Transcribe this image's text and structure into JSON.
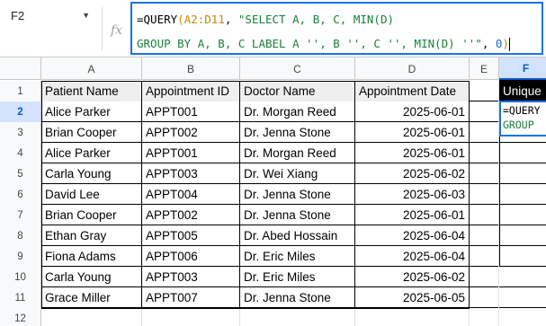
{
  "namebox": {
    "cell_ref": "F2"
  },
  "formula_bar": {
    "fx_label": "fx",
    "line1_prefix": "=QUERY",
    "line1_paren": "(",
    "line1_range": "A2:D11",
    "line1_sep": ", ",
    "line1_string": "\"SELECT A, B, C, MIN(D)",
    "line2_string": "GROUP BY A, B, C LABEL A '', B '', C '', MIN(D) ''\"",
    "line2_sep": ", ",
    "line2_num": "0",
    "line2_paren": ")"
  },
  "columns": [
    "A",
    "B",
    "C",
    "D",
    "E",
    "F"
  ],
  "selected_column": "F",
  "row_numbers": [
    "1",
    "2",
    "3",
    "4",
    "5",
    "6",
    "7",
    "8",
    "9",
    "10",
    "11",
    "12"
  ],
  "selected_row": "2",
  "table": {
    "headers": [
      "Patient Name",
      "Appointment ID",
      "Doctor Name",
      "Appointment Date"
    ],
    "rows": [
      [
        "Alice Parker",
        "APPT001",
        "Dr. Morgan Reed",
        "2025-06-01"
      ],
      [
        "Brian Cooper",
        "APPT002",
        "Dr. Jenna Stone",
        "2025-06-01"
      ],
      [
        "Alice Parker",
        "APPT001",
        "Dr. Morgan Reed",
        "2025-06-01"
      ],
      [
        "Carla Young",
        "APPT003",
        "Dr. Wei Xiang",
        "2025-06-02"
      ],
      [
        "David Lee",
        "APPT004",
        "Dr. Jenna Stone",
        "2025-06-03"
      ],
      [
        "Brian Cooper",
        "APPT002",
        "Dr. Jenna Stone",
        "2025-06-01"
      ],
      [
        "Ethan Gray",
        "APPT005",
        "Dr. Abed Hossain",
        "2025-06-04"
      ],
      [
        "Fiona Adams",
        "APPT006",
        "Dr. Eric Miles",
        "2025-06-04"
      ],
      [
        "Carla Young",
        "APPT003",
        "Dr. Eric Miles",
        "2025-06-02"
      ],
      [
        "Grace Miller",
        "APPT007",
        "Dr. Jenna Stone",
        "2025-06-05"
      ]
    ]
  },
  "f_column": {
    "header_text": "Unique"
  },
  "active_cell": {
    "line1": "=QUERY",
    "line2": "GROUP"
  },
  "colors": {
    "accent": "#1a73e8",
    "header_fill": "#efefef",
    "selected_header": "#d3e3fd"
  }
}
